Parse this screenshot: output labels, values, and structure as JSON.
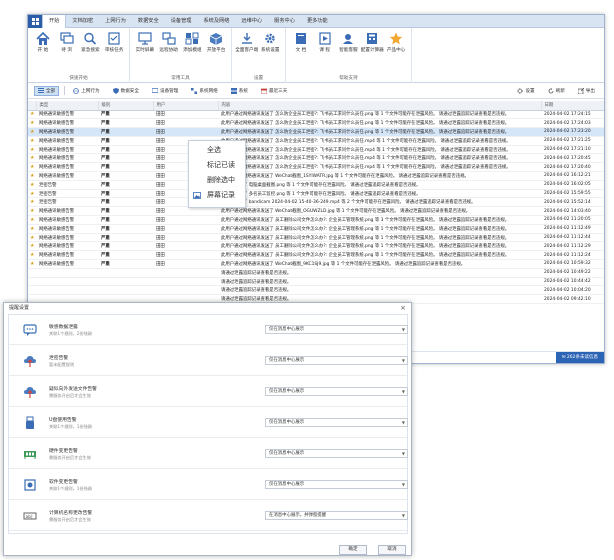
{
  "menubar": {
    "tabs": [
      "开始",
      "文档加密",
      "上网行为",
      "数据安全",
      "设备管理",
      "系统及网络",
      "远维中心",
      "服务中心",
      "更多功能"
    ]
  },
  "ribbon": {
    "groups": [
      {
        "label": "快速开始",
        "buttons": [
          {
            "label": "开 始",
            "icon": "home-icon"
          },
          {
            "label": "待 浏",
            "icon": "windows-icon"
          },
          {
            "label": "紧急搜索",
            "icon": "magnifier-icon"
          },
          {
            "label": "审核任务",
            "icon": "checklist-icon"
          }
        ]
      },
      {
        "label": "常用工具",
        "buttons": [
          {
            "label": "实时屏幕",
            "icon": "monitor-icon"
          },
          {
            "label": "远程协助",
            "icon": "remote-icon"
          },
          {
            "label": "添加模组",
            "icon": "modules-icon"
          },
          {
            "label": "开放平台",
            "icon": "cube-icon"
          }
        ]
      },
      {
        "label": "设置",
        "buttons": [
          {
            "label": "全面客户端",
            "icon": "download-icon"
          },
          {
            "label": "系统设置",
            "icon": "gear-icon"
          }
        ]
      },
      {
        "label": "帮助支持",
        "buttons": [
          {
            "label": "文 档",
            "icon": "book-icon"
          },
          {
            "label": "课 程",
            "icon": "course-icon"
          },
          {
            "label": "智能客服",
            "icon": "agent-icon"
          },
          {
            "label": "配置计算器",
            "icon": "calculator-icon"
          },
          {
            "label": "产品中心",
            "icon": "star-icon"
          }
        ]
      }
    ]
  },
  "toolbar": {
    "items": [
      "全部",
      "上网行为",
      "数据安全",
      "设备管理",
      "系统网络",
      "系统",
      "最近三天"
    ],
    "right": [
      "设置",
      "刷新",
      "导出"
    ]
  },
  "table": {
    "headers": [
      "类型",
      "级别",
      "用户",
      "内容",
      "日期"
    ],
    "rows": [
      {
        "type": "网络通讯敏感告警",
        "level": "严重",
        "user": "田田",
        "content": "此用户通过网络通讯发送了 怎么防企业员工泄密?: 飞书员工求问什么员任.png 等 1 个文件可能存在泄露风险。 请通过泄露追踪记录查看是否违规。",
        "date": "2024-04-02 17:24:15"
      },
      {
        "type": "网络通讯敏感告警",
        "level": "严重",
        "user": "田田",
        "content": "此用户通过网络通讯发送了 怎么防企业员工泄密?: 飞书员工求问什么员任.png 等 1 个文件可能存在泄露风险。 请通过泄露追踪记录查看是否违规。",
        "date": "2024-04-02 17:24:03"
      },
      {
        "type": "网络通讯敏感告警",
        "level": "严重",
        "user": "田田",
        "content": "此用户通过网络通讯发送了 怎么防企业员工泄密?: 飞书员工求问什么员任.png 等 1 个文件可能存在泄露风险。 请通过泄露追踪记录查看是否违规。",
        "date": "2024-04-02 17:23:20"
      },
      {
        "type": "网络通讯敏感告警",
        "level": "严重",
        "user": "田田",
        "content": "此用户通过网络通讯发送了 怎么防企业员工泄密?: 飞书员工求问什么员任.mp4 等 1 个文件可能存在泄露风险。 请通过泄露追踪记录查看是否违规。",
        "date": "2024-04-02 17:21:25"
      },
      {
        "type": "网络通讯敏感告警",
        "level": "严重",
        "user": "田田",
        "content": "此用户通过网络通讯发送了 怎么防企业员工泄密?: 飞书员工求问什么员任.mp4 等 1 个文件可能存在泄露风险。 请通过泄露追踪记录查看是否违规。",
        "date": "2024-04-02 17:21:10"
      },
      {
        "type": "网络通讯敏感告警",
        "level": "严重",
        "user": "田田",
        "content": "此用户通过网络通讯发送了 怎么防企业员工泄密?: 飞书员工求问什么员任.mp4 等 1 个文件可能存在泄露风险。 请通过泄露追踪记录查看是否违规。",
        "date": "2024-04-02 17:20:45"
      },
      {
        "type": "网络通讯敏感告警",
        "level": "严重",
        "user": "田田",
        "content": "此用户通过网络通讯发送了 怎么防企业员工泄密?: 飞书员工求问什么员任.mp4 等 1 个文件可能存在泄露风险。 请通过泄露追踪记录查看是否违规。",
        "date": "2024-04-02 17:20:40"
      },
      {
        "type": "网络通讯敏感告警",
        "level": "严重",
        "user": "田田",
        "content": "此用户通过网络通讯发送了 WeChat截图_1SYIWATR.jpg 等 1 个文件可能存在泄露风险。 请通过泄露追踪记录查看是否违规。",
        "date": "2024-04-02 16:12:21"
      },
      {
        "type": "泄密告警",
        "level": "严重",
        "user": "田田",
        "content": "此用户操作了 电脑桌面截图.png 等 1 个文件可能存在泄露风险。 请通过泄露追踪记录查看是否违规。",
        "date": "2024-04-02 16:02:05"
      },
      {
        "type": "泄密告警",
        "level": "严重",
        "user": "田田",
        "content": "此用户操作了 多名员工监控.png 等 1 个文件可能存在泄露风险。 请通过泄露追踪记录查看是否违规。",
        "date": "2024-04-02 15:59:55"
      },
      {
        "type": "泄密告警",
        "level": "严重",
        "user": "田田",
        "content": "此用户操作了 bandicam 2024-04-02 15-40-36-249.mp4 等 2 个文件可能存在泄露风险。 请通过泄露追踪记录查看是否违规。",
        "date": "2024-04-02 15:52:14"
      },
      {
        "type": "网络通讯敏感告警",
        "level": "严重",
        "user": "田田",
        "content": "此用户通过网络通讯发送了 WeChat截图_OGUWZLD.jpg 等 1 个文件可能存在泄露风险。 请通过泄露追踪记录查看是否违规。",
        "date": "2024-04-02 14:03:40"
      },
      {
        "type": "网络通讯敏感告警",
        "level": "严重",
        "user": "田田",
        "content": "此用户通过网络通讯发送了 员工删除公司文件怎么办?: 企业员工管理系统.png 等 3 个文件可能存在泄露风险。 请通过泄露追踪记录查看是否违规。",
        "date": "2024-04-02 11:20:05"
      },
      {
        "type": "网络通讯敏感告警",
        "level": "严重",
        "user": "田田",
        "content": "此用户通过网络通讯发送了 员工删除公司文件怎么办?: 企业员工管理系统.png 等 1 个文件可能存在泄露风险。 请通过泄露追踪记录查看是否违规。",
        "date": "2024-04-02 11:12:49"
      },
      {
        "type": "网络通讯敏感告警",
        "level": "严重",
        "user": "田田",
        "content": "此用户通过网络通讯发送了 员工删除公司文件怎么办?: 企业员工管理系统.png 等 1 个文件可能存在泄露风险。 请通过泄露追踪记录查看是否违规。",
        "date": "2024-04-02 11:12:44"
      },
      {
        "type": "网络通讯敏感告警",
        "level": "严重",
        "user": "田田",
        "content": "此用户通过网络通讯发送了 员工删除公司文件怎么办?: 企业员工管理系统.png 等 1 个文件可能存在泄露风险。 请通过泄露追踪记录查看是否违规。",
        "date": "2024-04-02 11:12:29"
      },
      {
        "type": "网络通讯敏感告警",
        "level": "严重",
        "user": "田田",
        "content": "此用户通过网络通讯发送了 员工删除公司文件怎么办?: 企业员工管理系统.png 等 1 个文件可能存在泄露风险。 请通过泄露追踪记录查看是否违规。",
        "date": "2024-04-02 11:12:24"
      },
      {
        "type": "网络通讯敏感告警",
        "level": "严重",
        "user": "田田",
        "content": "此用户通过网络通讯发送了 WeChat截图_9KC1SJ9.jpg 等 1 个文件可能存在泄露风险。 请通过泄露追踪记录查看是否违规。",
        "date": "2024-04-02 10:59:32"
      },
      {
        "type": "",
        "level": "",
        "user": "",
        "content": "请通过泄露追踪记录查看是否违规。",
        "date": "2024-04-02 10:49:22"
      },
      {
        "type": "",
        "level": "",
        "user": "",
        "content": "请通过泄露追踪记录查看是否违规。",
        "date": "2024-04-02 10:44:42"
      },
      {
        "type": "",
        "level": "",
        "user": "",
        "content": "请通过泄露追踪记录查看是否违规。",
        "date": "2024-04-02 10:04:20"
      },
      {
        "type": "",
        "level": "",
        "user": "",
        "content": "请通过泄露追踪记录查看是否违规。",
        "date": "2024-04-02 09:42:10"
      }
    ]
  },
  "context_menu": {
    "items": [
      "全选",
      "标记已读",
      "删除选中",
      "屏幕记录"
    ]
  },
  "statusbar": {
    "unread": "262条未读信息"
  },
  "dialog": {
    "title": "提醒设置",
    "close": "×",
    "rows": [
      {
        "title": "敏感数据泄露",
        "desc": "关联1个规则，2份残跡",
        "value": "仅在消息中心展示",
        "icon": "chat-bubble-icon"
      },
      {
        "title": "泄密告警",
        "desc": "暂未配置规则",
        "value": "仅在消息中心展示",
        "icon": "upload-cloud-icon"
      },
      {
        "title": "疑似向外发送文件告警",
        "desc": "需服务开启后才会生效",
        "value": "仅在消息中心展示",
        "icon": "upload-cloud-icon"
      },
      {
        "title": "U盘使用告警",
        "desc": "关联1个规则，1份残跡",
        "value": "仅在消息中心展示",
        "icon": "usb-icon"
      },
      {
        "title": "硬件变更告警",
        "desc": "需服务开启后才会生效",
        "value": "仅在消息中心展示",
        "icon": "memory-chip-icon"
      },
      {
        "title": "软件变更告警",
        "desc": "关联1个规则，1份残跡",
        "value": "仅在消息中心展示",
        "icon": "software-box-icon"
      },
      {
        "title": "计算机名称更改告警",
        "desc": "需服务开启后才会生效",
        "value": "在消息中心展示，并弹窗提醒",
        "icon": "rename-icon"
      }
    ],
    "ok": "确定",
    "cancel": "取消"
  }
}
